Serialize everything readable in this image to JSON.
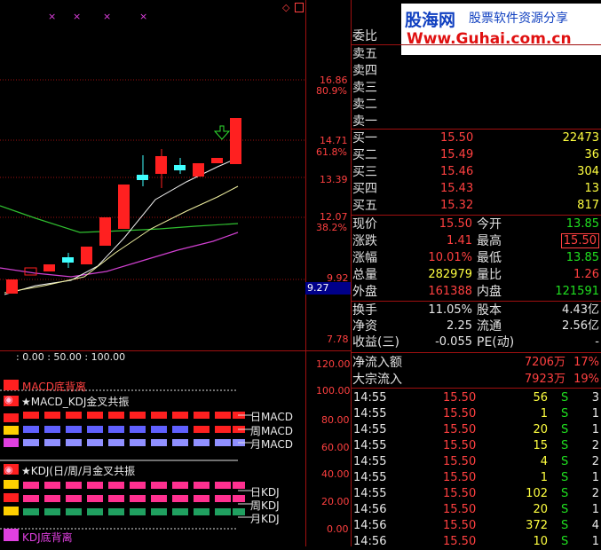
{
  "chart": {
    "price_labels": [
      "16.86",
      "80.9%",
      "14.71",
      "61.8%",
      "13.39",
      "12.07",
      "38.2%",
      "9.92",
      "7.78"
    ],
    "current_price_tag": "9.27",
    "marker_x": "×",
    "indicator_header": ": 0.00 : 50.00 : 100.00",
    "indicator_ticks": [
      "120.00",
      "100.00",
      "80.00",
      "60.00",
      "40.00",
      "20.00",
      "0.00"
    ]
  },
  "indicator": {
    "macd_div_label": "MACD底背离",
    "macd_kdj_label": "★MACD_KDJ金叉共振",
    "day_macd": "日MACD",
    "week_macd": "周MACD",
    "month_macd": "月MACD",
    "kdj_label": "★KDJ(日/周/月金叉共振",
    "day_kdj": "日KDJ",
    "week_kdj": "周KDJ",
    "month_kdj": "月KDJ",
    "kdj_div_label": "KDJ底背离"
  },
  "watermark": {
    "brand": "股海网",
    "slogan": "股票软件资源分享",
    "url": "Www.Guhai.com.cn"
  },
  "quote": {
    "weibi": "委比",
    "sell": [
      {
        "label": "卖五",
        "price": "",
        "vol": ""
      },
      {
        "label": "卖四",
        "price": "",
        "vol": ""
      },
      {
        "label": "卖三",
        "price": "",
        "vol": ""
      },
      {
        "label": "卖二",
        "price": "",
        "vol": ""
      },
      {
        "label": "卖一",
        "price": "",
        "vol": ""
      }
    ],
    "buy": [
      {
        "label": "买一",
        "price": "15.50",
        "vol": "22473"
      },
      {
        "label": "买二",
        "price": "15.49",
        "vol": "36"
      },
      {
        "label": "买三",
        "price": "15.46",
        "vol": "304"
      },
      {
        "label": "买四",
        "price": "15.43",
        "vol": "13"
      },
      {
        "label": "买五",
        "price": "15.32",
        "vol": "817"
      }
    ],
    "stats": [
      {
        "l1": "现价",
        "v1": "15.50",
        "l2": "今开",
        "v2": "13.85"
      },
      {
        "l1": "涨跌",
        "v1": "1.41",
        "l2": "最高",
        "v2": "15.50"
      },
      {
        "l1": "涨幅",
        "v1": "10.01%",
        "l2": "最低",
        "v2": "13.85"
      },
      {
        "l1": "总量",
        "v1": "282979",
        "l2": "量比",
        "v2": "1.26"
      },
      {
        "l1": "外盘",
        "v1": "161388",
        "l2": "内盘",
        "v2": "121591"
      }
    ],
    "stats2": [
      {
        "l1": "换手",
        "v1": "11.05%",
        "l2": "股本",
        "v2": "4.43亿"
      },
      {
        "l1": "净资",
        "v1": "2.25",
        "l2": "流通",
        "v2": "2.56亿"
      },
      {
        "l1": "收益(三)",
        "v1": "-0.055",
        "l2": "PE(动)",
        "v2": "-"
      }
    ],
    "flow": [
      {
        "label": "净流入额",
        "value": "7206万",
        "pct": "17%"
      },
      {
        "label": "大宗流入",
        "value": "7923万",
        "pct": "19%"
      }
    ],
    "ticks": [
      {
        "time": "14:55",
        "price": "15.50",
        "vol": "56",
        "side": "S",
        "n": "3"
      },
      {
        "time": "14:55",
        "price": "15.50",
        "vol": "1",
        "side": "S",
        "n": "1"
      },
      {
        "time": "14:55",
        "price": "15.50",
        "vol": "20",
        "side": "S",
        "n": "1"
      },
      {
        "time": "14:55",
        "price": "15.50",
        "vol": "15",
        "side": "S",
        "n": "2"
      },
      {
        "time": "14:55",
        "price": "15.50",
        "vol": "4",
        "side": "S",
        "n": "2"
      },
      {
        "time": "14:55",
        "price": "15.50",
        "vol": "1",
        "side": "S",
        "n": "1"
      },
      {
        "time": "14:55",
        "price": "15.50",
        "vol": "102",
        "side": "S",
        "n": "2"
      },
      {
        "time": "14:56",
        "price": "15.50",
        "vol": "20",
        "side": "S",
        "n": "1"
      },
      {
        "time": "14:56",
        "price": "15.50",
        "vol": "372",
        "side": "S",
        "n": "4"
      },
      {
        "time": "14:56",
        "price": "15.50",
        "vol": "10",
        "side": "S",
        "n": "1"
      }
    ]
  }
}
